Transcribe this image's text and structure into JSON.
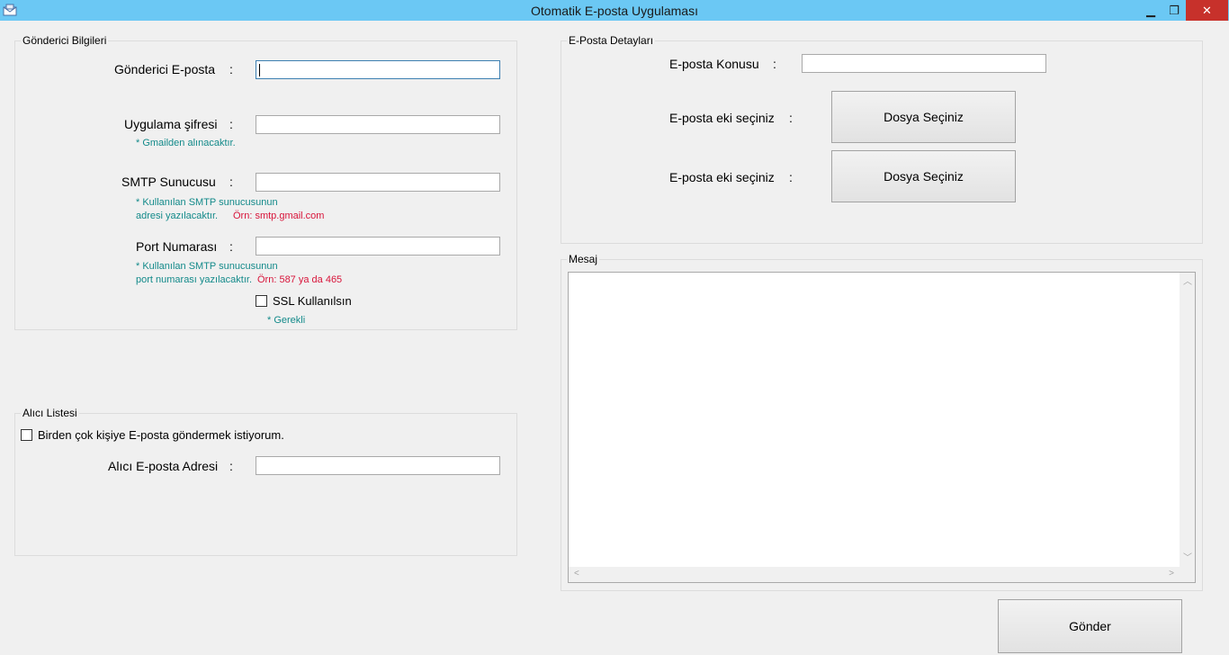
{
  "window": {
    "title": "Otomatik E-posta Uygulaması",
    "controls": {
      "minimize": "▁",
      "maximize": "❐",
      "close": "✕"
    }
  },
  "sender": {
    "group_title": "Gönderici Bilgileri",
    "email_label": "Gönderici E-posta",
    "email_value": "",
    "password_label": "Uygulama şifresi",
    "password_value": "",
    "password_hint": "* Gmailden alınacaktır.",
    "smtp_label": "SMTP Sunucusu",
    "smtp_value": "",
    "smtp_hint_line1": "* Kullanılan SMTP sunucusunun",
    "smtp_hint_line2": "adresi yazılacaktır.",
    "smtp_example": "Örn: smtp.gmail.com",
    "port_label": "Port Numarası",
    "port_value": "",
    "port_hint_line1": "* Kullanılan SMTP sunucusunun",
    "port_hint_line2": "port numarası yazılacaktır.",
    "port_example": "Örn: 587  ya da 465",
    "ssl_label": "SSL Kullanılsın",
    "ssl_checked": false,
    "required_hint": "* Gerekli",
    "colon": ":"
  },
  "recipients": {
    "group_title": "Alıcı Listesi",
    "multi_label": "Birden çok kişiye E-posta göndermek istiyorum.",
    "multi_checked": false,
    "address_label": "Alıcı E-posta Adresi",
    "address_value": "",
    "colon": ":"
  },
  "details": {
    "group_title": "E-Posta Detayları",
    "subject_label": "E-posta Konusu",
    "subject_value": "",
    "attachment1_label": "E-posta eki seçiniz",
    "attachment1_button": "Dosya Seçiniz",
    "attachment2_label": "E-posta eki seçiniz",
    "attachment2_button": "Dosya Seçiniz",
    "colon": ":"
  },
  "message": {
    "group_title": "Mesaj",
    "body": ""
  },
  "send_button": "Gönder",
  "colors": {
    "titlebar": "#6bc8f4",
    "close_button": "#c7312b",
    "hint_text": "#138a8a",
    "example_text": "#d8143a"
  }
}
